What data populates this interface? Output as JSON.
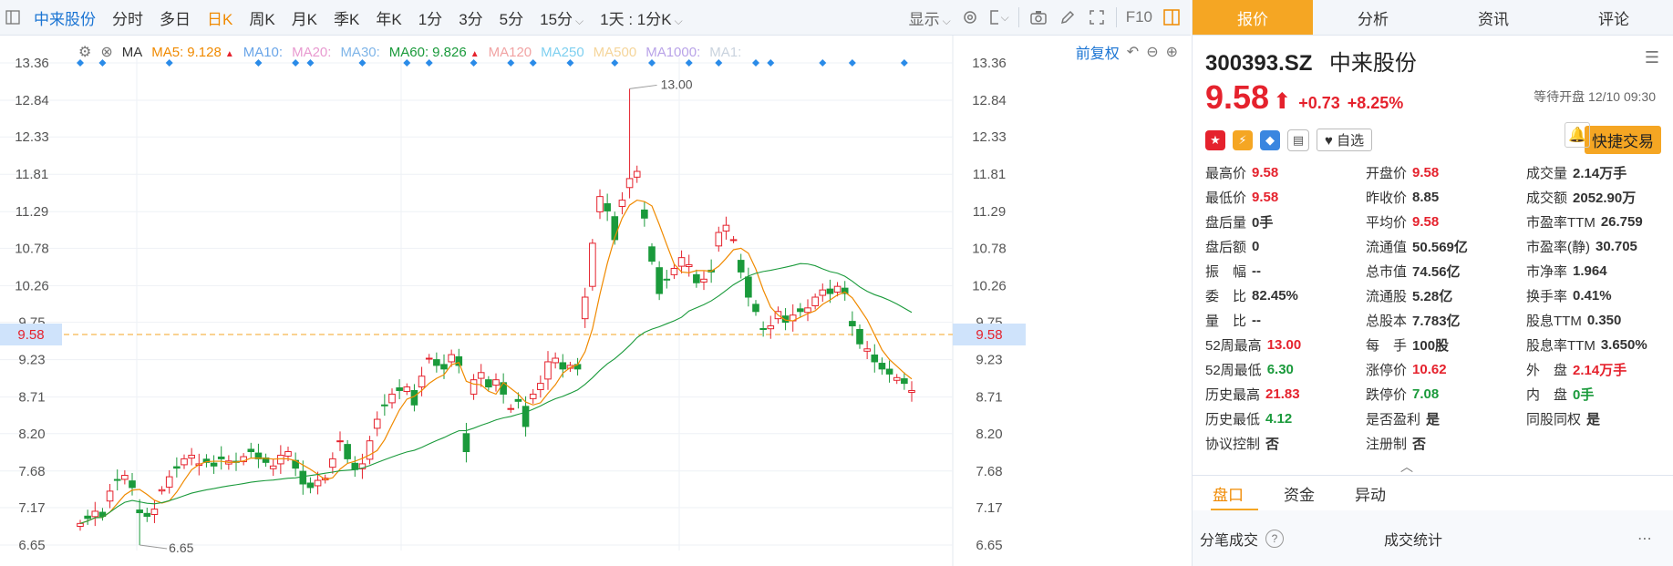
{
  "toolbar": {
    "stock_name": "中来股份",
    "periods": [
      "分时",
      "多日",
      "日K",
      "周K",
      "月K",
      "季K",
      "年K",
      "1分",
      "3分",
      "5分",
      "15分"
    ],
    "active_period": "日K",
    "period_select": "1天 : 1分K",
    "display": "显示",
    "f10": "F10"
  },
  "ma": {
    "label": "MA",
    "items": [
      {
        "name": "MA5:",
        "value": "9.128",
        "color": "#f08a00",
        "arrow": "▲"
      },
      {
        "name": "MA10:",
        "value": "",
        "color": "#6aa5e8"
      },
      {
        "name": "MA20:",
        "value": "",
        "color": "#e89ad0"
      },
      {
        "name": "MA30:",
        "value": "",
        "color": "#7fb5e8"
      },
      {
        "name": "MA60:",
        "value": "9.826",
        "color": "#1a9a3b",
        "arrow": "▲"
      },
      {
        "name": "MA120",
        "value": "",
        "color": "#f1a3a3"
      },
      {
        "name": "MA250",
        "value": "",
        "color": "#7fd0f0"
      },
      {
        "name": "MA500",
        "value": "",
        "color": "#f5d59a"
      },
      {
        "name": "MA1000:",
        "value": "",
        "color": "#b9a3e8"
      },
      {
        "name": "MA1:",
        "value": "",
        "color": "#c9d3de"
      }
    ],
    "adjust": "前复权"
  },
  "axis": {
    "ticks": [
      "13.36",
      "12.84",
      "12.33",
      "11.81",
      "11.29",
      "10.78",
      "10.26",
      "9.75",
      "9.23",
      "8.71",
      "8.20",
      "7.68",
      "7.17",
      "6.65"
    ],
    "current": "9.58",
    "high_label": "13.00",
    "low_label": "6.65"
  },
  "chart_data": {
    "type": "candlestick",
    "ylim": [
      6.65,
      13.36
    ],
    "closes": [
      6.95,
      7.02,
      7.12,
      7.05,
      7.4,
      7.55,
      7.62,
      7.45,
      7.1,
      7.05,
      7.15,
      7.42,
      7.6,
      7.72,
      7.85,
      7.9,
      7.78,
      7.8,
      7.75,
      7.85,
      7.82,
      7.8,
      7.88,
      7.95,
      7.85,
      7.8,
      7.75,
      7.9,
      7.95,
      7.72,
      7.5,
      7.45,
      7.55,
      7.58,
      7.85,
      8.1,
      7.85,
      7.7,
      7.78,
      8.1,
      8.4,
      8.6,
      8.75,
      8.8,
      8.85,
      8.6,
      9.0,
      9.25,
      9.15,
      9.1,
      9.3,
      9.15,
      7.95,
      8.95,
      9.05,
      8.85,
      8.95,
      8.75,
      8.55,
      8.65,
      8.3,
      8.75,
      8.9,
      9.2,
      9.25,
      9.1,
      9.15,
      9.1,
      10.1,
      10.85,
      11.5,
      11.3,
      10.9,
      11.45,
      11.75,
      11.85,
      11.2,
      10.6,
      10.15,
      10.35,
      10.5,
      10.65,
      10.55,
      10.3,
      10.35,
      10.45,
      11.0,
      11.1,
      10.9,
      10.45,
      10.1,
      9.9,
      9.65,
      9.7,
      9.9,
      9.75,
      9.85,
      9.9,
      9.95,
      10.1,
      10.2,
      10.15,
      10.25,
      10.15,
      9.7,
      9.45,
      9.38,
      9.2,
      9.1,
      9.03,
      8.98,
      8.9,
      8.8
    ]
  },
  "panel": {
    "tabs": [
      "报价",
      "分析",
      "资讯",
      "评论"
    ],
    "code": "300393.SZ",
    "name": "中来股份",
    "price": "9.58",
    "change": "+0.73",
    "pct": "+8.25%",
    "status": "等待开盘 12/10 09:30",
    "watch": "自选",
    "quick": "快捷交易",
    "stats": [
      {
        "l": "最高价",
        "v": "9.58",
        "c": "red"
      },
      {
        "l": "开盘价",
        "v": "9.58",
        "c": "red"
      },
      {
        "l": "成交量",
        "v": "2.14万手",
        "c": ""
      },
      {
        "l": "最低价",
        "v": "9.58",
        "c": "red"
      },
      {
        "l": "昨收价",
        "v": "8.85",
        "c": ""
      },
      {
        "l": "成交额",
        "v": "2052.90万",
        "c": ""
      },
      {
        "l": "盘后量",
        "v": "0手",
        "c": ""
      },
      {
        "l": "平均价",
        "v": "9.58",
        "c": "red"
      },
      {
        "l": "市盈率TTM",
        "v": "26.759",
        "c": ""
      },
      {
        "l": "盘后额",
        "v": "0",
        "c": ""
      },
      {
        "l": "流通值",
        "v": "50.569亿",
        "c": ""
      },
      {
        "l": "市盈率(静)",
        "v": "30.705",
        "c": ""
      },
      {
        "l": "振　幅",
        "v": "--",
        "c": ""
      },
      {
        "l": "总市值",
        "v": "74.56亿",
        "c": ""
      },
      {
        "l": "市净率",
        "v": "1.964",
        "c": ""
      },
      {
        "l": "委　比",
        "v": "82.45%",
        "c": ""
      },
      {
        "l": "流通股",
        "v": "5.28亿",
        "c": ""
      },
      {
        "l": "换手率",
        "v": "0.41%",
        "c": ""
      },
      {
        "l": "量　比",
        "v": "--",
        "c": ""
      },
      {
        "l": "总股本",
        "v": "7.783亿",
        "c": ""
      },
      {
        "l": "股息TTM",
        "v": "0.350",
        "c": ""
      },
      {
        "l": "52周最高",
        "v": "13.00",
        "c": "red"
      },
      {
        "l": "每　手",
        "v": "100股",
        "c": ""
      },
      {
        "l": "股息率TTM",
        "v": "3.650%",
        "c": ""
      },
      {
        "l": "52周最低",
        "v": "6.30",
        "c": "green"
      },
      {
        "l": "涨停价",
        "v": "10.62",
        "c": "red"
      },
      {
        "l": "外　盘",
        "v": "2.14万手",
        "c": "red"
      },
      {
        "l": "历史最高",
        "v": "21.83",
        "c": "red"
      },
      {
        "l": "跌停价",
        "v": "7.08",
        "c": "green"
      },
      {
        "l": "内　盘",
        "v": "0手",
        "c": "green"
      },
      {
        "l": "历史最低",
        "v": "4.12",
        "c": "green"
      },
      {
        "l": "是否盈利",
        "v": "是",
        "c": ""
      },
      {
        "l": "同股同权",
        "v": "是",
        "c": ""
      },
      {
        "l": "协议控制",
        "v": "否",
        "c": ""
      },
      {
        "l": "注册制",
        "v": "否",
        "c": ""
      },
      {
        "l": "",
        "v": "",
        "c": ""
      }
    ],
    "bottom_tabs": [
      "盘口",
      "资金",
      "异动"
    ],
    "trades": "分笔成交",
    "trade_stats": "成交统计"
  }
}
